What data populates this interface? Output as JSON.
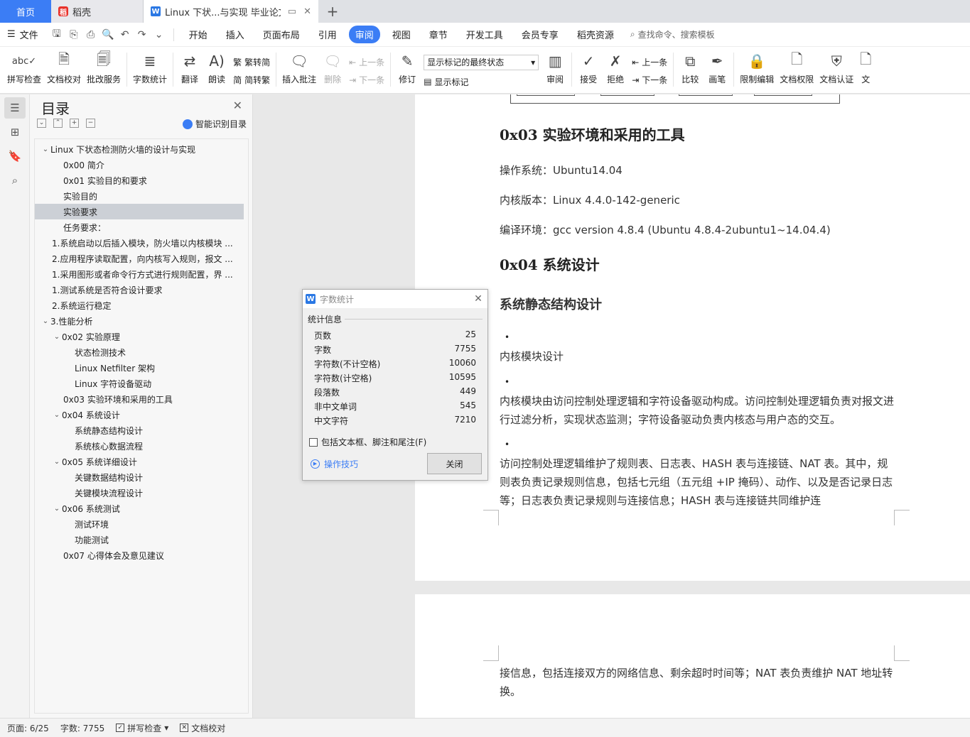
{
  "tabs": {
    "home": "首页",
    "wk": "稻壳",
    "doc": "Linux 下状...与实现 毕业论文"
  },
  "menu": {
    "file": "文件",
    "items": [
      "开始",
      "插入",
      "页面布局",
      "引用",
      "审阅",
      "视图",
      "章节",
      "开发工具",
      "会员专享",
      "稻壳资源"
    ],
    "active": "审阅",
    "search": "查找命令、搜索模板"
  },
  "ribbon": {
    "spellcheck": "拼写检查",
    "proofread": "文档校对",
    "review_service": "批改服务",
    "word_count": "字数统计",
    "translate": "翻译",
    "read_aloud": "朗读",
    "to_traditional": "繁转简",
    "to_simplified": "简转繁",
    "insert_comment": "插入批注",
    "delete": "删除",
    "prev_comment": "上一条",
    "next_comment": "下一条",
    "track_changes": "修订",
    "display_mode": "显示标记的最终状态",
    "show_markup": "显示标记",
    "review": "审阅",
    "accept": "接受",
    "reject": "拒绝",
    "prev_change": "上一条",
    "next_change": "下一条",
    "compare": "比较",
    "pen": "画笔",
    "restrict_edit": "限制编辑",
    "doc_permission": "文档权限",
    "doc_certify": "文档认证",
    "more": "文"
  },
  "toc": {
    "title": "目录",
    "smart": "智能识别目录",
    "items": [
      {
        "text": "Linux 下状态检测防火墙的设计与实现",
        "level": 0,
        "caret": "v"
      },
      {
        "text": "0x00 简介",
        "level": 1,
        "caret": ""
      },
      {
        "text": "0x01 实验目的和要求",
        "level": 1,
        "caret": ""
      },
      {
        "text": "实验目的",
        "level": 1,
        "caret": ""
      },
      {
        "text": "实验要求",
        "level": 1,
        "caret": "",
        "selected": true
      },
      {
        "text": "任务要求：",
        "level": 1,
        "caret": ""
      },
      {
        "text": "1.系统启动以后插入模块，防火墙以内核模块 ...",
        "level": -1,
        "caret": ""
      },
      {
        "text": "2.应用程序读取配置，向内核写入规则，报文 ...",
        "level": -1,
        "caret": ""
      },
      {
        "text": "1.采用图形或者命令行方式进行规则配置，界 ...",
        "level": -1,
        "caret": ""
      },
      {
        "text": "1.测试系统是否符合设计要求",
        "level": -1,
        "caret": ""
      },
      {
        "text": "2.系统运行稳定",
        "level": -1,
        "caret": ""
      },
      {
        "text": "3.性能分析",
        "level": 0,
        "caret": "v"
      },
      {
        "text": "0x02 实验原理",
        "level": 1,
        "caret": "v"
      },
      {
        "text": "状态检测技术",
        "level": 2,
        "caret": ""
      },
      {
        "text": "Linux Netfilter 架构",
        "level": 2,
        "caret": ""
      },
      {
        "text": "Linux 字符设备驱动",
        "level": 2,
        "caret": ""
      },
      {
        "text": "0x03 实验环境和采用的工具",
        "level": 1,
        "caret": ""
      },
      {
        "text": "0x04 系统设计",
        "level": 1,
        "caret": "v"
      },
      {
        "text": "系统静态结构设计",
        "level": 2,
        "caret": ""
      },
      {
        "text": "系统核心数据流程",
        "level": 2,
        "caret": ""
      },
      {
        "text": "0x05 系统详细设计",
        "level": 1,
        "caret": "v"
      },
      {
        "text": "关键数据结构设计",
        "level": 2,
        "caret": ""
      },
      {
        "text": "关键模块流程设计",
        "level": 2,
        "caret": ""
      },
      {
        "text": "0x06 系统测试",
        "level": 1,
        "caret": "v"
      },
      {
        "text": "测试环境",
        "level": 2,
        "caret": ""
      },
      {
        "text": "功能测试",
        "level": 2,
        "caret": ""
      },
      {
        "text": "0x07 心得体会及意见建议",
        "level": 1,
        "caret": ""
      }
    ]
  },
  "doc": {
    "h_env": "0x03  实验环境和采用的工具",
    "os": "操作系统：Ubuntu14.04",
    "kernel": "内核版本：Linux 4.4.0-142-generic",
    "compiler": "编译环境：gcc version 4.8.4 (Ubuntu 4.8.4-2ubuntu1~14.04.4)",
    "h_design": "0x04  系统设计",
    "h_static": "系统静态结构设计",
    "bullet": "•",
    "kmod": "内核模块设计",
    "kmod_desc": "内核模块由访问控制处理逻辑和字符设备驱动构成。访问控制处理逻辑负责对报文进行过滤分析，实现状态监测；字符设备驱动负责内核态与用户态的交互。",
    "acl_desc": "访问控制处理逻辑维护了规则表、日志表、HASH 表与连接链、NAT 表。其中，规则表负责记录规则信息，包括七元组（五元组 +IP 掩码）、动作、以及是否记录日志等；日志表负责记录规则与连接信息；HASH 表与连接链共同维护连",
    "page2_text": "接信息，包括连接双方的网络信息、剩余超时时间等；NAT 表负责维护 NAT 地址转换。"
  },
  "dialog": {
    "title": "字数统计",
    "section": "统计信息",
    "rows": [
      {
        "label": "页数",
        "value": "25"
      },
      {
        "label": "字数",
        "value": "7755"
      },
      {
        "label": "字符数(不计空格)",
        "value": "10060"
      },
      {
        "label": "字符数(计空格)",
        "value": "10595"
      },
      {
        "label": "段落数",
        "value": "449"
      },
      {
        "label": "非中文单词",
        "value": "545"
      },
      {
        "label": "中文字符",
        "value": "7210"
      }
    ],
    "include": "包括文本框、脚注和尾注(F)",
    "tips": "操作技巧",
    "close": "关闭"
  },
  "status": {
    "page": "页面: 6/25",
    "words": "字数: 7755",
    "spell": "拼写检查",
    "proof": "文档校对"
  },
  "colors": {
    "accent": "#3b7df5"
  }
}
